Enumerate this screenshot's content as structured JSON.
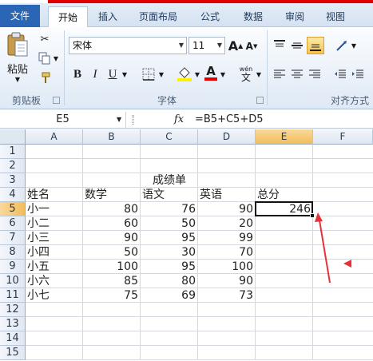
{
  "tabs": [
    "文件",
    "开始",
    "插入",
    "页面布局",
    "公式",
    "数据",
    "审阅",
    "视图"
  ],
  "ribbon": {
    "paste_label": "粘贴",
    "clipboard_label": "剪贴板",
    "font_label": "字体",
    "align_label": "对齐方式",
    "font_name": "宋体",
    "font_size": "11",
    "bold": "B",
    "italic": "I",
    "underline": "U",
    "wen": "wén",
    "wen_char": "文",
    "grow_font": "A",
    "shrink_font": "A",
    "font_color_letter": "A"
  },
  "formula_bar": {
    "name_box": "E5",
    "fx": "fx",
    "formula": "=B5+C5+D5"
  },
  "columns": [
    "A",
    "B",
    "C",
    "D",
    "E",
    "F"
  ],
  "rows": [
    "1",
    "2",
    "3",
    "4",
    "5",
    "6",
    "7",
    "8",
    "9",
    "10",
    "11",
    "12",
    "13",
    "14",
    "15"
  ],
  "selected": {
    "column": "E",
    "row": "5"
  },
  "sheet": {
    "title": "成绩单",
    "headers": [
      "姓名",
      "数学",
      "语文",
      "英语",
      "总分"
    ],
    "records": [
      {
        "name": "小一",
        "math": "80",
        "chinese": "76",
        "english": "90",
        "total": "246"
      },
      {
        "name": "小二",
        "math": "60",
        "chinese": "50",
        "english": "20",
        "total": ""
      },
      {
        "name": "小三",
        "math": "90",
        "chinese": "95",
        "english": "99",
        "total": ""
      },
      {
        "name": "小四",
        "math": "50",
        "chinese": "30",
        "english": "70",
        "total": ""
      },
      {
        "name": "小五",
        "math": "100",
        "chinese": "95",
        "english": "100",
        "total": ""
      },
      {
        "name": "小六",
        "math": "85",
        "chinese": "80",
        "english": "90",
        "total": ""
      },
      {
        "name": "小七",
        "math": "75",
        "chinese": "69",
        "english": "73",
        "total": ""
      }
    ]
  },
  "colors": {
    "annotation_red": "#e8303a",
    "file_tab": "#2a65b6",
    "selection_header": "#f2bd5b"
  }
}
